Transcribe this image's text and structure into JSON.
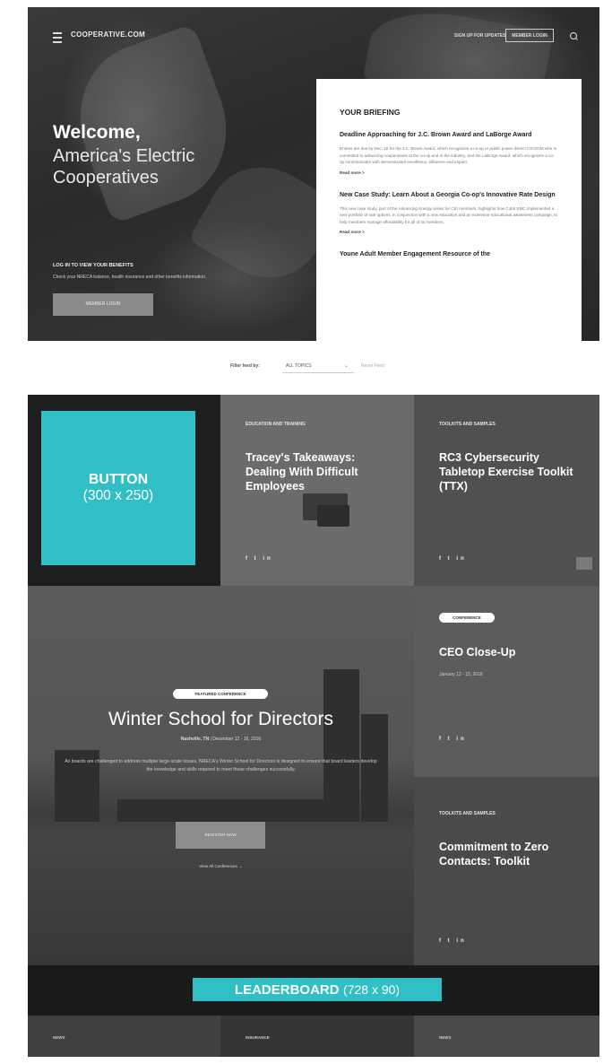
{
  "header": {
    "logo": "COOPERATIVE.COM",
    "sign_up": "SIGN UP FOR UPDATES",
    "login": "MEMBER LOGIN"
  },
  "hero": {
    "welcome": "Welcome,",
    "tagline": "America's Electric Cooperatives",
    "benefits_title": "LOG IN TO VIEW YOUR BENEFITS",
    "benefits_text": "Check your NRECA balance, health insurance and other benefits information.",
    "cta": "MEMBER LOGIN"
  },
  "briefing": {
    "title": "YOUR BRIEFING",
    "items": [
      {
        "headline": "Deadline Approaching for J.C. Brown Award and LaBorge Award",
        "body": "Entries are due by Dec. 18 for the J.C. Brown Award, which recognizes a co-op or public power district CEO/GM who is committed to advancing cooperatives at the co-op and in the industry, and the LaBorge Award, which recognizes a co-op communicator with demonstrated excellence, influence and impact.",
        "more": "Read more >"
      },
      {
        "headline": "New Case Study: Learn About a Georgia Co-op's Innovative Rate Design",
        "body": "This new case study, part of the Advancing Energy series for CEI members, highlights how Cobb EMC implemented a new portfolio of rate options, in conjunction with a new education and an extensive educational awareness campaign, to help members manage affordability for all of its members.",
        "more": "Read more >"
      },
      {
        "headline": "Youne Adult Member Engagement Resource of the",
        "body": "",
        "more": ""
      }
    ]
  },
  "filter": {
    "label": "Filter feed by:",
    "value": "ALL TOPICS",
    "reset": "Reset Feed"
  },
  "grid": {
    "ad_button": {
      "label": "BUTTON",
      "size": "(300 x 250)"
    },
    "tracey": {
      "kicker": "EDUCATION AND TRAINING",
      "title": "Tracey's Takeaways: Dealing With Difficult Employees",
      "social": "f  t  in"
    },
    "rc3": {
      "kicker": "TOOLKITS AND SAMPLES",
      "title": "RC3 Cybersecurity Tabletop Exercise Toolkit (TTX)",
      "social": "f  t  in"
    },
    "winter": {
      "badge": "FEATURED CONFERENCE",
      "title": "Winter School for Directors",
      "location": "Nashville, TN",
      "dates": "December 12 - 16, 2016",
      "description": "As boards are challenged to address multiple large-scale issues, NRECA's Winter School for Directors is designed to ensure that board leaders develop the knowledge and skills required to meet those challenges successfully.",
      "cta": "REGISTER NOW",
      "link": "View All Conferences →"
    },
    "ceo": {
      "badge": "CONFERENCE",
      "title": "CEO Close-Up",
      "dates": "January 12 - 15, 2016",
      "social": "f  t  in"
    },
    "zero": {
      "kicker": "TOOLKITS AND SAMPLES",
      "title": "Commitment to Zero Contacts: Toolkit",
      "social": "f  t  in"
    }
  },
  "leaderboard": {
    "label": "LEADERBOARD",
    "size": "(728 x 90)"
  },
  "bottom": {
    "labels": [
      "NEWS",
      "INSURANCE",
      "NEWS"
    ]
  },
  "colors": {
    "ad_accent": "#31bfc6",
    "dark": "#1e1e1e"
  }
}
